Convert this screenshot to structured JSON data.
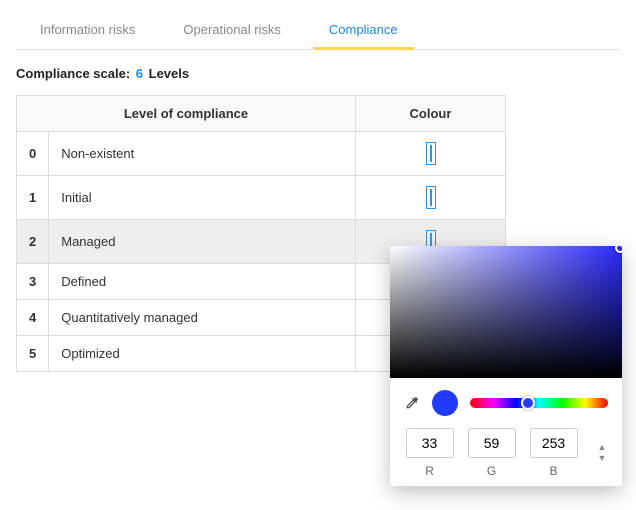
{
  "tabs": [
    {
      "label": "Information risks",
      "active": false
    },
    {
      "label": "Operational risks",
      "active": false
    },
    {
      "label": "Compliance",
      "active": true
    }
  ],
  "scale": {
    "label": "Compliance scale:",
    "count": "6",
    "unit": "Levels"
  },
  "table": {
    "headers": {
      "level": "Level of compliance",
      "colour": "Colour"
    },
    "rows": [
      {
        "idx": "0",
        "name": "Non-existent",
        "swatch": "#ffffff",
        "selected": false
      },
      {
        "idx": "1",
        "name": "Initial",
        "swatch": "#e8641b",
        "selected": false
      },
      {
        "idx": "2",
        "name": "Managed",
        "swatch": "#213bfd",
        "selected": true
      },
      {
        "idx": "3",
        "name": "Defined",
        "swatch": null,
        "selected": false
      },
      {
        "idx": "4",
        "name": "Quantitatively managed",
        "swatch": null,
        "selected": false
      },
      {
        "idx": "5",
        "name": "Optimized",
        "swatch": null,
        "selected": false
      }
    ]
  },
  "picker": {
    "preview": "#213bfd",
    "r": "33",
    "g": "59",
    "b": "253",
    "labels": {
      "r": "R",
      "g": "G",
      "b": "B"
    }
  }
}
